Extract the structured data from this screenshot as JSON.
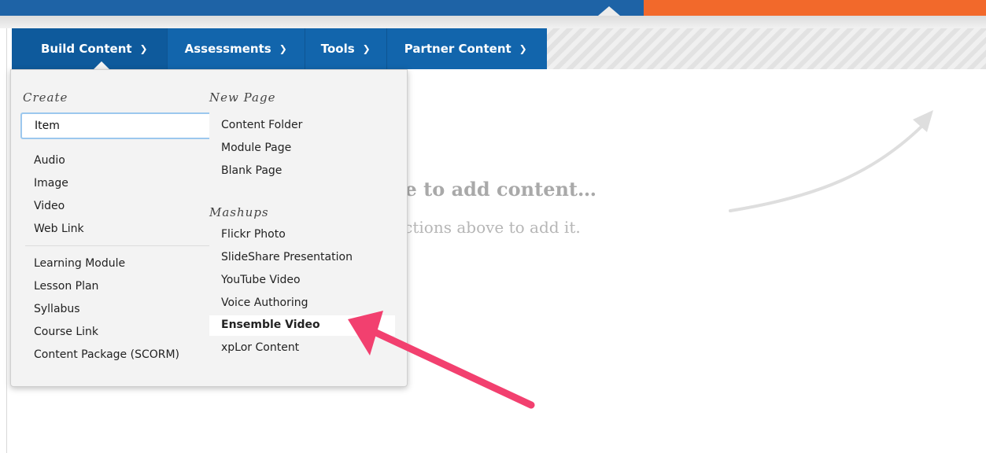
{
  "nav": {
    "tabs": [
      {
        "label": "Build Content"
      },
      {
        "label": "Assessments"
      },
      {
        "label": "Tools"
      },
      {
        "label": "Partner Content"
      }
    ]
  },
  "dropdown": {
    "create": {
      "heading": "Create",
      "item": "Item",
      "group1": [
        "Audio",
        "Image",
        "Video",
        "Web Link"
      ],
      "group2": [
        "Learning Module",
        "Lesson Plan",
        "Syllabus",
        "Course Link",
        "Content Package (SCORM)"
      ]
    },
    "new_page": {
      "heading": "New Page",
      "items": [
        "Content Folder",
        "Module Page",
        "Blank Page"
      ]
    },
    "mashups": {
      "heading": "Mashups",
      "items": [
        "Flickr Photo",
        "SlideShare Presentation",
        "YouTube Video",
        "Voice Authoring",
        "Ensemble Video",
        "xpLor Content"
      ]
    }
  },
  "empty_state": {
    "title": "ime to add content…",
    "subtitle": "functions above to add it."
  },
  "colors": {
    "brand_blue": "#1265ac",
    "accent_orange": "#f2692b",
    "annotation_pink": "#f2406f"
  }
}
